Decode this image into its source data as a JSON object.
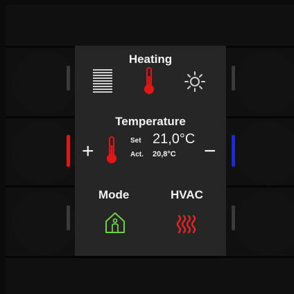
{
  "heating": {
    "title": "Heating",
    "icons": [
      "blinds-icon",
      "thermometer-icon",
      "sun-icon"
    ]
  },
  "temperature": {
    "title": "Temperature",
    "set_label": "Set",
    "set_value": "21,0°C",
    "act_label": "Act.",
    "act_value": "20,8°C",
    "plus": "+",
    "minus": "−"
  },
  "mode": {
    "mode_label": "Mode",
    "hvac_label": "HVAC"
  },
  "colors": {
    "led_idle": "#3a3a3a",
    "led_red": "#e11616",
    "led_blue": "#1b2bd8",
    "home_green": "#6fd04a",
    "heat_red": "#e52323"
  }
}
